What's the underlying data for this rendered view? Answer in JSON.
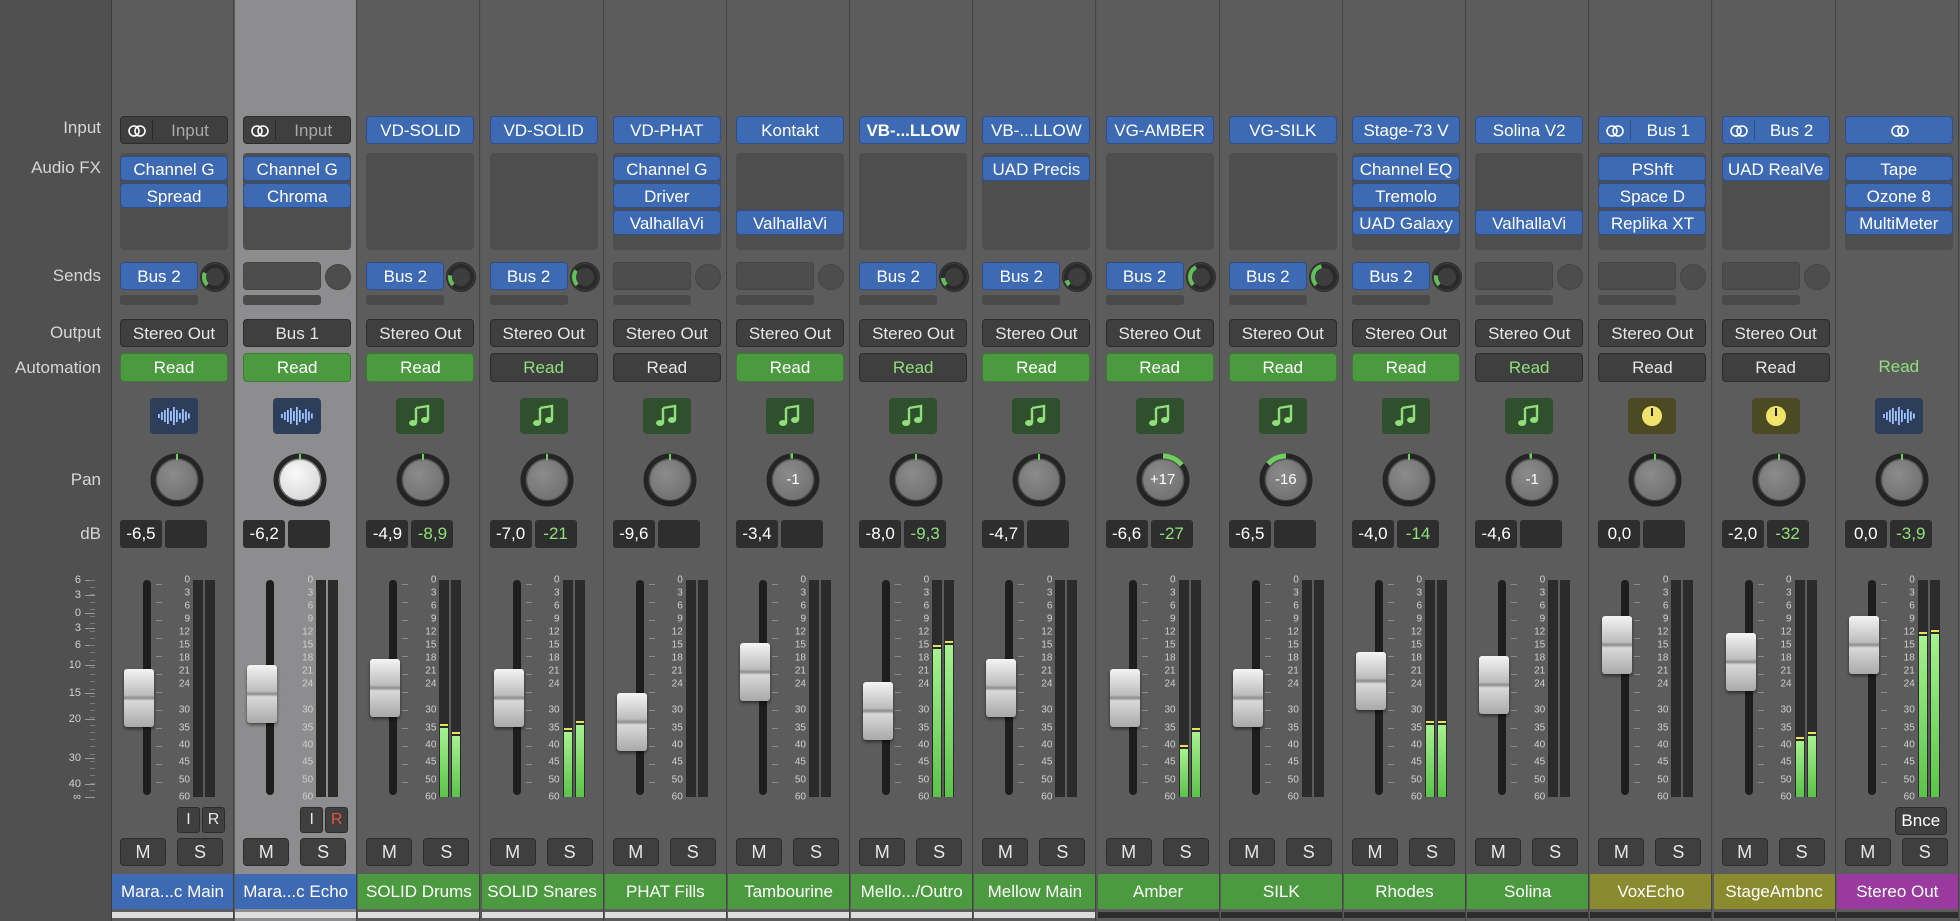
{
  "row_labels": {
    "input": "Input",
    "audio_fx": "Audio FX",
    "sends": "Sends",
    "output": "Output",
    "automation": "Automation",
    "pan": "Pan",
    "db": "dB"
  },
  "fader_scale": [
    "6",
    "3",
    "0",
    "3",
    "6",
    "10",
    "15",
    "20",
    "30",
    "40",
    "∞"
  ],
  "meter_scale": [
    "0",
    "3",
    "6",
    "9",
    "12",
    "15",
    "18",
    "21",
    "24",
    "30",
    "35",
    "40",
    "45",
    "50",
    "60"
  ],
  "bounce_label": "Bnce",
  "colors": {
    "blue_plugin": "#3e6ab3",
    "green_read": "#4c9a3f",
    "name_blue": "#3e6ab3",
    "name_green": "#4c9a3f",
    "name_olive": "#8a8a2e",
    "name_magenta": "#9a3a9e",
    "meter_green": "#5ac449"
  },
  "strips": [
    {
      "name": "Mara...c Main",
      "name_color": "blue",
      "input": "Input",
      "input_kind": "stereo-dark",
      "fx": [
        "Channel G",
        "Spread"
      ],
      "send": "Bus 2",
      "send_level": 0.25,
      "output": "Stereo Out",
      "automation": "Read",
      "automation_on": true,
      "icon": "audio-waveform-icon",
      "pan": "",
      "pan_offset": 0,
      "db_volume": "-6,5",
      "db_peak": "",
      "fader": 0.45,
      "meter_l": 0,
      "meter_r": 0,
      "mute": "M",
      "solo": "S",
      "input_monitor": "I",
      "record": "R",
      "record_armed": false,
      "selected": false
    },
    {
      "name": "Mara...c Echo",
      "name_color": "blue",
      "input": "Input",
      "input_kind": "stereo-dark",
      "fx": [
        "Channel G",
        "Chroma"
      ],
      "send": "",
      "send_level": 0,
      "output": "Bus 1",
      "automation": "Read",
      "automation_on": true,
      "icon": "audio-waveform-icon",
      "pan": "",
      "pan_offset": 0,
      "db_volume": "-6,2",
      "db_peak": "",
      "fader": 0.47,
      "meter_l": 0,
      "meter_r": 0,
      "mute": "M",
      "solo": "S",
      "input_monitor": "I",
      "record": "R",
      "record_armed": true,
      "selected": true
    },
    {
      "name": "SOLID Drums",
      "name_color": "green",
      "input": "VD-SOLID",
      "input_kind": "blue",
      "fx": [],
      "send": "Bus 2",
      "send_level": 0.2,
      "output": "Stereo Out",
      "automation": "Read",
      "automation_on": true,
      "icon": "music-note-icon",
      "pan": "",
      "pan_offset": 0,
      "db_volume": "-4,9",
      "db_peak": "-8,9",
      "fader": 0.5,
      "meter_l": 0.32,
      "meter_r": 0.28,
      "mute": "M",
      "solo": "S",
      "selected": false
    },
    {
      "name": "SOLID Snares",
      "name_color": "green",
      "input": "VD-SOLID",
      "input_kind": "blue",
      "fx": [],
      "send": "Bus 2",
      "send_level": 0.3,
      "output": "Stereo Out",
      "automation": "Read",
      "automation_on": false,
      "icon": "music-note-icon",
      "pan": "",
      "pan_offset": 0,
      "db_volume": "-7,0",
      "db_peak": "-21",
      "fader": 0.45,
      "meter_l": 0.3,
      "meter_r": 0.33,
      "mute": "M",
      "solo": "S",
      "selected": false
    },
    {
      "name": "PHAT Fills",
      "name_color": "green",
      "input": "VD-PHAT",
      "input_kind": "blue",
      "fx": [
        "Channel G",
        "Driver",
        "ValhallaVi"
      ],
      "send": "",
      "send_level": 0,
      "output": "Stereo Out",
      "automation": "Read",
      "automation_on": false,
      "icon": "music-note-icon",
      "pan": "",
      "pan_offset": 0,
      "db_volume": "-9,6",
      "db_peak": "",
      "fader": 0.34,
      "meter_l": 0,
      "meter_r": 0,
      "mute": "M",
      "solo": "S",
      "selected": false
    },
    {
      "name": "Tambourine",
      "name_color": "green",
      "input": "Kontakt",
      "input_kind": "blue",
      "fx": [
        "ValhallaVi"
      ],
      "fx_bottom": true,
      "send": "",
      "send_level": 0,
      "output": "Stereo Out",
      "automation": "Read",
      "automation_on": true,
      "icon": "music-note-icon",
      "pan": "-1",
      "pan_offset": -0.02,
      "db_volume": "-3,4",
      "db_peak": "",
      "fader": 0.57,
      "meter_l": 0,
      "meter_r": 0,
      "mute": "M",
      "solo": "S",
      "selected": false
    },
    {
      "name": "Mello.../Outro",
      "name_color": "green",
      "input": "VB-...LLOW",
      "input_kind": "blue-bold",
      "fx": [],
      "send": "Bus 2",
      "send_level": 0.15,
      "output": "Stereo Out",
      "automation": "Read",
      "automation_on": false,
      "icon": "music-note-icon",
      "pan": "",
      "pan_offset": 0,
      "db_volume": "-8,0",
      "db_peak": "-9,3",
      "fader": 0.39,
      "meter_l": 0.68,
      "meter_r": 0.7,
      "mute": "M",
      "solo": "S",
      "selected": false
    },
    {
      "name": "Mellow Main",
      "name_color": "green",
      "input": "VB-...LLOW",
      "input_kind": "blue",
      "fx": [
        "UAD Precis"
      ],
      "send": "Bus 2",
      "send_level": 0.1,
      "output": "Stereo Out",
      "automation": "Read",
      "automation_on": true,
      "icon": "music-note-icon",
      "pan": "",
      "pan_offset": 0,
      "db_volume": "-4,7",
      "db_peak": "",
      "fader": 0.5,
      "meter_l": 0,
      "meter_r": 0,
      "mute": "M",
      "solo": "S",
      "selected": false
    },
    {
      "name": "Amber",
      "name_color": "green",
      "input": "VG-AMBER",
      "input_kind": "blue",
      "fx": [],
      "send": "Bus 2",
      "send_level": 0.4,
      "output": "Stereo Out",
      "automation": "Read",
      "automation_on": true,
      "icon": "music-note-icon",
      "pan": "+17",
      "pan_offset": 0.17,
      "db_volume": "-6,6",
      "db_peak": "-27",
      "fader": 0.45,
      "meter_l": 0.22,
      "meter_r": 0.3,
      "mute": "M",
      "solo": "S",
      "selected": false
    },
    {
      "name": "SILK",
      "name_color": "green",
      "input": "VG-SILK",
      "input_kind": "blue",
      "fx": [],
      "send": "Bus 2",
      "send_level": 0.45,
      "output": "Stereo Out",
      "automation": "Read",
      "automation_on": true,
      "icon": "music-note-icon",
      "pan": "-16",
      "pan_offset": -0.16,
      "db_volume": "-6,5",
      "db_peak": "",
      "fader": 0.45,
      "meter_l": 0,
      "meter_r": 0,
      "mute": "M",
      "solo": "S",
      "selected": false
    },
    {
      "name": "Rhodes",
      "name_color": "green",
      "input": "Stage-73 V",
      "input_kind": "blue",
      "fx": [
        "Channel EQ",
        "Tremolo",
        "UAD Galaxy"
      ],
      "send": "Bus 2",
      "send_level": 0.2,
      "output": "Stereo Out",
      "automation": "Read",
      "automation_on": true,
      "icon": "music-note-icon",
      "pan": "",
      "pan_offset": 0,
      "db_volume": "-4,0",
      "db_peak": "-14",
      "fader": 0.53,
      "meter_l": 0.33,
      "meter_r": 0.33,
      "mute": "M",
      "solo": "S",
      "selected": false
    },
    {
      "name": "Solina",
      "name_color": "green",
      "input": "Solina V2",
      "input_kind": "blue",
      "fx": [
        "ValhallaVi"
      ],
      "fx_bottom": true,
      "send": "",
      "send_level": 0,
      "output": "Stereo Out",
      "automation": "Read",
      "automation_on": false,
      "icon": "music-note-icon",
      "pan": "-1",
      "pan_offset": -0.02,
      "db_volume": "-4,6",
      "db_peak": "",
      "fader": 0.51,
      "meter_l": 0,
      "meter_r": 0,
      "mute": "M",
      "solo": "S",
      "selected": false
    },
    {
      "name": "VoxEcho",
      "name_color": "olive",
      "input": "Bus 1",
      "input_kind": "stereo-blue",
      "fx": [
        "PShft",
        "Space D",
        "Replika XT"
      ],
      "send": "",
      "send_level": 0,
      "output": "Stereo Out",
      "automation": "Read",
      "automation_on": false,
      "icon": "aux-knob-icon",
      "pan": "",
      "pan_offset": 0,
      "db_volume": "0,0",
      "db_peak": "",
      "fader": 0.7,
      "meter_l": 0,
      "meter_r": 0,
      "mute": "M",
      "solo": "S",
      "selected": false
    },
    {
      "name": "StageAmbnc",
      "name_color": "olive",
      "input": "Bus 2",
      "input_kind": "stereo-blue",
      "fx": [
        "UAD RealVe"
      ],
      "send": "",
      "send_level": 0,
      "output": "Stereo Out",
      "automation": "Read",
      "automation_on": false,
      "icon": "aux-knob-icon",
      "pan": "",
      "pan_offset": 0,
      "db_volume": "-2,0",
      "db_peak": "-32",
      "fader": 0.62,
      "meter_l": 0.26,
      "meter_r": 0.28,
      "mute": "M",
      "solo": "S",
      "selected": false
    },
    {
      "name": "Stereo Out",
      "name_color": "magenta",
      "input": "",
      "input_kind": "stereo-blue",
      "fx": [
        "Tape",
        "Ozone 8",
        "MultiMeter"
      ],
      "send": "",
      "send_level": 0,
      "output": "",
      "automation": "Read",
      "automation_on": false,
      "automation_plain": true,
      "icon": "audio-waveform-icon",
      "pan": "",
      "pan_offset": 0,
      "db_volume": "0,0",
      "db_peak": "-3,9",
      "fader": 0.7,
      "meter_l": 0.74,
      "meter_r": 0.75,
      "mute": "M",
      "solo": "S",
      "bounce": true,
      "selected": false
    }
  ]
}
